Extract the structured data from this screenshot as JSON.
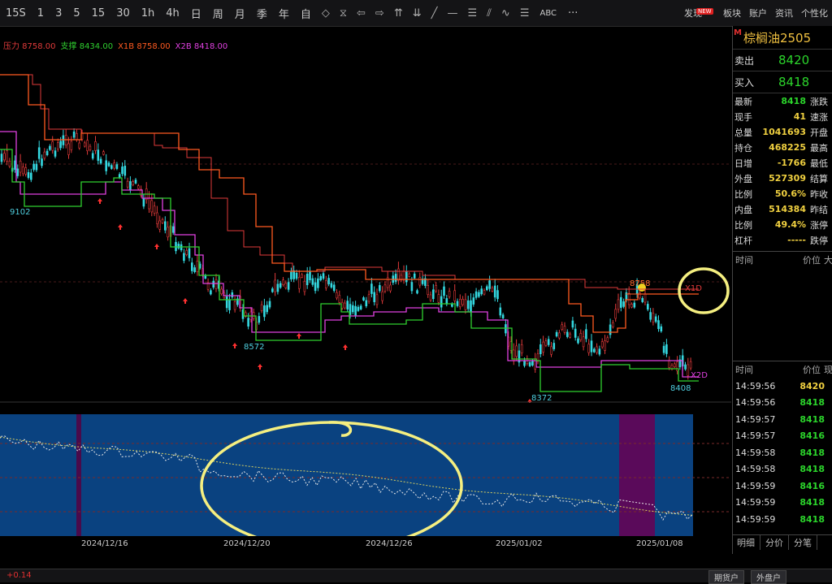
{
  "toolbar": {
    "periods": [
      "15S",
      "1",
      "3",
      "5",
      "15",
      "30",
      "1h",
      "4h",
      "日",
      "周",
      "月",
      "季",
      "年",
      "自"
    ],
    "icons": [
      "diamond-left-icon",
      "hourglass-icon",
      "arrow-left-icon",
      "arrow-right-icon",
      "double-up-icon",
      "double-down-icon",
      "line-draw-icon",
      "hline-icon",
      "menu-icon",
      "multi-line-icon",
      "wave-icon",
      "fib-icon"
    ],
    "abc": "ABC",
    "more": "···",
    "right": [
      "发现",
      "板块",
      "账户",
      "资讯",
      "个性化"
    ],
    "new_badge": "NEW"
  },
  "legend": [
    {
      "label": "压力 8758.00",
      "color": "#e03a3a"
    },
    {
      "label": "支撑 8434.00",
      "color": "#2fcf2f"
    },
    {
      "label": "X1B 8758.00",
      "color": "#ff5a20"
    },
    {
      "label": "X2B 8418.00",
      "color": "#e040e0"
    }
  ],
  "main_labels": {
    "low1": "9102",
    "low2": "8572",
    "low3": "8372",
    "last": "8408",
    "high": "8758",
    "tag1": "X1D",
    "tag2": "X2D"
  },
  "dates": [
    "2024/12/16",
    "2024/12/20",
    "2024/12/26",
    "2025/01/02",
    "2025/01/08"
  ],
  "quote": {
    "m": "M",
    "name": "棕榈油2505",
    "sell_label": "卖出",
    "sell": "8420",
    "buy_label": "买入",
    "buy": "8418",
    "stats": [
      {
        "l": "最新",
        "v": "8418",
        "g": true,
        "r": "涨跌"
      },
      {
        "l": "现手",
        "v": "41",
        "g": false,
        "r": "速涨"
      },
      {
        "l": "总量",
        "v": "1041693",
        "g": false,
        "r": "开盘"
      },
      {
        "l": "持仓",
        "v": "468225",
        "g": false,
        "r": "最高"
      },
      {
        "l": "日增",
        "v": "-1766",
        "g": false,
        "r": "最低"
      },
      {
        "l": "外盘",
        "v": "527309",
        "g": false,
        "r": "结算"
      },
      {
        "l": "比例",
        "v": "50.6%",
        "g": false,
        "r": "昨收"
      },
      {
        "l": "内盘",
        "v": "514384",
        "g": false,
        "r": "昨结"
      },
      {
        "l": "比例",
        "v": "49.4%",
        "g": false,
        "r": "涨停"
      },
      {
        "l": "杠杆",
        "v": "-----",
        "g": false,
        "r": "跌停"
      }
    ],
    "hdr1": {
      "time": "时间",
      "price": "价位",
      "vol": "大"
    },
    "hdr2": {
      "time": "时间",
      "price": "价位",
      "vol": "现"
    },
    "ticks": [
      {
        "t": "14:59:56",
        "p": "8420",
        "y": true
      },
      {
        "t": "14:59:56",
        "p": "8418",
        "y": false
      },
      {
        "t": "14:59:57",
        "p": "8418",
        "y": false
      },
      {
        "t": "14:59:57",
        "p": "8416",
        "y": false
      },
      {
        "t": "14:59:58",
        "p": "8418",
        "y": false
      },
      {
        "t": "14:59:58",
        "p": "8418",
        "y": false
      },
      {
        "t": "14:59:59",
        "p": "8416",
        "y": false
      },
      {
        "t": "14:59:59",
        "p": "8418",
        "y": false
      },
      {
        "t": "14:59:59",
        "p": "8418",
        "y": false
      }
    ],
    "tabs": [
      "明细",
      "分价",
      "分笔"
    ]
  },
  "bottom": {
    "chg": "+0.14",
    "btn1": "期货户",
    "btn2": "外盘户"
  }
}
